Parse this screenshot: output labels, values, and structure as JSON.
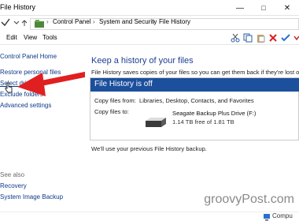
{
  "window": {
    "title": "File History",
    "minimize": "—",
    "maximize": "□",
    "close": "✕"
  },
  "address": {
    "breadcrumbs": [
      "Control Panel",
      "System and Security",
      "File History"
    ],
    "separator": "›"
  },
  "menu": {
    "items": [
      "Edit",
      "View",
      "Tools"
    ]
  },
  "sidebar": {
    "home": "Control Panel Home",
    "links": [
      "Restore personal files",
      "Select drive",
      "Exclude folders",
      "Advanced settings"
    ],
    "see_also_label": "See also",
    "see_also": [
      "Recovery",
      "System Image Backup"
    ]
  },
  "main": {
    "heading": "Keep a history of your files",
    "description": "File History saves copies of your files so you can get them back if they're lost or dama",
    "panel": {
      "status": "File History is off",
      "copy_from_label": "Copy files from:",
      "copy_from_value": "Libraries, Desktop, Contacts, and Favorites",
      "copy_to_label": "Copy files to:",
      "drive_name": "Seagate Backup Plus Drive (F:)",
      "drive_space": "1.14 TB free of 1.81 TB"
    },
    "footnote": "We'll use your previous File History backup."
  },
  "statusbar": {
    "right_text": "Compu"
  },
  "watermark": "groovyPost.com",
  "colors": {
    "panel_header": "#1c4f9c",
    "link": "#0d3a8a",
    "heading": "#1e3f8f",
    "arrow": "#e02020"
  },
  "icons": [
    "checkmark-icon",
    "folder-icon",
    "cut-icon",
    "copy-icon",
    "paste-icon",
    "delete-icon",
    "check-icon",
    "drive-icon",
    "cursor-icon",
    "arrow-icon"
  ]
}
